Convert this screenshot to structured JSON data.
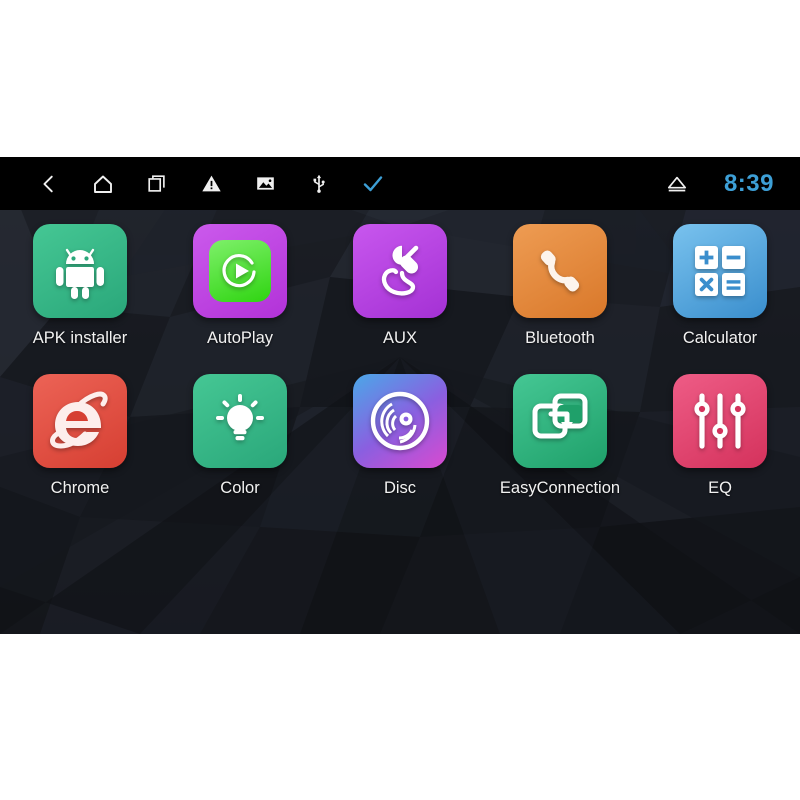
{
  "device": {
    "screen_background": "#191b20"
  },
  "status_bar": {
    "background": "#000000",
    "clock": "8:39",
    "clock_color": "#3d9fd6",
    "left_icons": [
      {
        "name": "back-icon",
        "label": "Back"
      },
      {
        "name": "home-icon",
        "label": "Home"
      },
      {
        "name": "recents-icon",
        "label": "Recent apps"
      },
      {
        "name": "warning-icon",
        "label": "Warning"
      },
      {
        "name": "image-icon",
        "label": "Screenshot"
      },
      {
        "name": "usb-icon",
        "label": "USB"
      },
      {
        "name": "check-icon",
        "label": "Confirm"
      }
    ],
    "right_icons": [
      {
        "name": "eject-icon",
        "label": "Eject"
      }
    ]
  },
  "apps": {
    "rows": [
      [
        {
          "label": "APK installer",
          "icon": "android-robot-icon",
          "tile_from": "#3fc08a",
          "tile_to": "#2aa77a"
        },
        {
          "label": "AutoPlay",
          "icon": "play-circle-icon",
          "tile_from": "#c750e8",
          "tile_to": "#b83fdc"
        },
        {
          "label": "AUX",
          "icon": "aux-plug-icon",
          "tile_from": "#c04ae8",
          "tile_to": "#a63ad6"
        },
        {
          "label": "Bluetooth",
          "icon": "phone-handset-icon",
          "tile_from": "#e8944a",
          "tile_to": "#d97f33"
        },
        {
          "label": "Calculator",
          "icon": "calculator-keys-icon",
          "tile_from": "#6fb9e8",
          "tile_to": "#3f93d1"
        }
      ],
      [
        {
          "label": "Chrome",
          "icon": "internet-explorer-e-icon",
          "tile_from": "#e8584a",
          "tile_to": "#d94236"
        },
        {
          "label": "Color",
          "icon": "light-bulb-icon",
          "tile_from": "#3fc08a",
          "tile_to": "#2aa77a"
        },
        {
          "label": "Disc",
          "icon": "vinyl-disc-icon",
          "tile_from": "#4aa8e8",
          "tile_to": "#d44ad0"
        },
        {
          "label": "EasyConnection",
          "icon": "screen-mirror-icon",
          "tile_from": "#3fc08a",
          "tile_to": "#22a06b"
        },
        {
          "label": "EQ",
          "icon": "equalizer-sliders-icon",
          "tile_from": "#e8527d",
          "tile_to": "#d43a63"
        }
      ]
    ]
  }
}
